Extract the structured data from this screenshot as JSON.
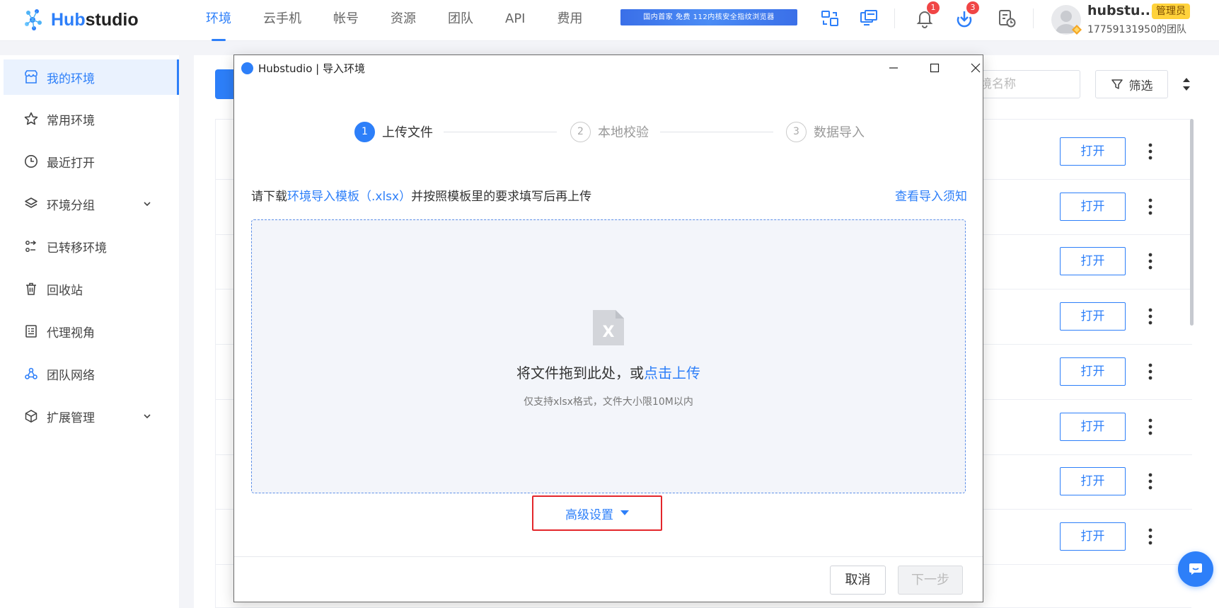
{
  "app": {
    "logo_hub": "Hub",
    "logo_studio": "studio"
  },
  "nav": {
    "items": [
      {
        "label": "环境",
        "active": true
      },
      {
        "label": "云手机",
        "active": false
      },
      {
        "label": "帐号",
        "active": false
      },
      {
        "label": "资源",
        "active": false
      },
      {
        "label": "团队",
        "active": false
      },
      {
        "label": "API",
        "active": false
      },
      {
        "label": "费用",
        "active": false
      }
    ],
    "banner_text": "国内首家 免费 112内核安全指纹浏览器"
  },
  "header": {
    "notifications_count": "1",
    "downloads_count": "3",
    "user_name": "hubstu...",
    "role": "管理员",
    "team_name": "17759131950的团队"
  },
  "sidebar": {
    "items": [
      {
        "label": "我的环境",
        "icon": "shop-icon",
        "active": true
      },
      {
        "label": "常用环境",
        "icon": "star-icon"
      },
      {
        "label": "最近打开",
        "icon": "clock-icon"
      },
      {
        "label": "环境分组",
        "icon": "layers-icon",
        "expandable": true
      },
      {
        "label": "已转移环境",
        "icon": "transfer-icon"
      },
      {
        "label": "回收站",
        "icon": "trash-icon"
      },
      {
        "label": "代理视角",
        "icon": "proxy-icon"
      },
      {
        "label": "团队网络",
        "icon": "network-icon"
      },
      {
        "label": "扩展管理",
        "icon": "cube-icon",
        "expandable": true
      }
    ]
  },
  "main": {
    "search_placeholder": "境名称",
    "filter_label": "筛选",
    "row_action_label": "打开",
    "row_count": 8
  },
  "modal": {
    "title": "Hubstudio | 导入环境",
    "steps": [
      {
        "number": "1",
        "label": "上传文件",
        "state": "active"
      },
      {
        "number": "2",
        "label": "本地校验",
        "state": "pending"
      },
      {
        "number": "3",
        "label": "数据导入",
        "state": "pending"
      }
    ],
    "instruction_prefix": "请下载",
    "instruction_link": "环境导入模板（.xlsx）",
    "instruction_suffix": "并按照模板里的要求填写后再上传",
    "notice_link": "查看导入须知",
    "file_icon_letter": "X",
    "drop_text": "将文件拖到此处，或",
    "drop_link": "点击上传",
    "drop_hint": "仅支持xlsx格式，文件大小限10M以内",
    "advanced_label": "高级设置",
    "cancel_label": "取消",
    "next_label": "下一步"
  },
  "colors": {
    "accent": "#2d7ff9",
    "highlight_border": "#e3262b",
    "badge": "#f04545",
    "role_badge": "#ffd23b"
  }
}
